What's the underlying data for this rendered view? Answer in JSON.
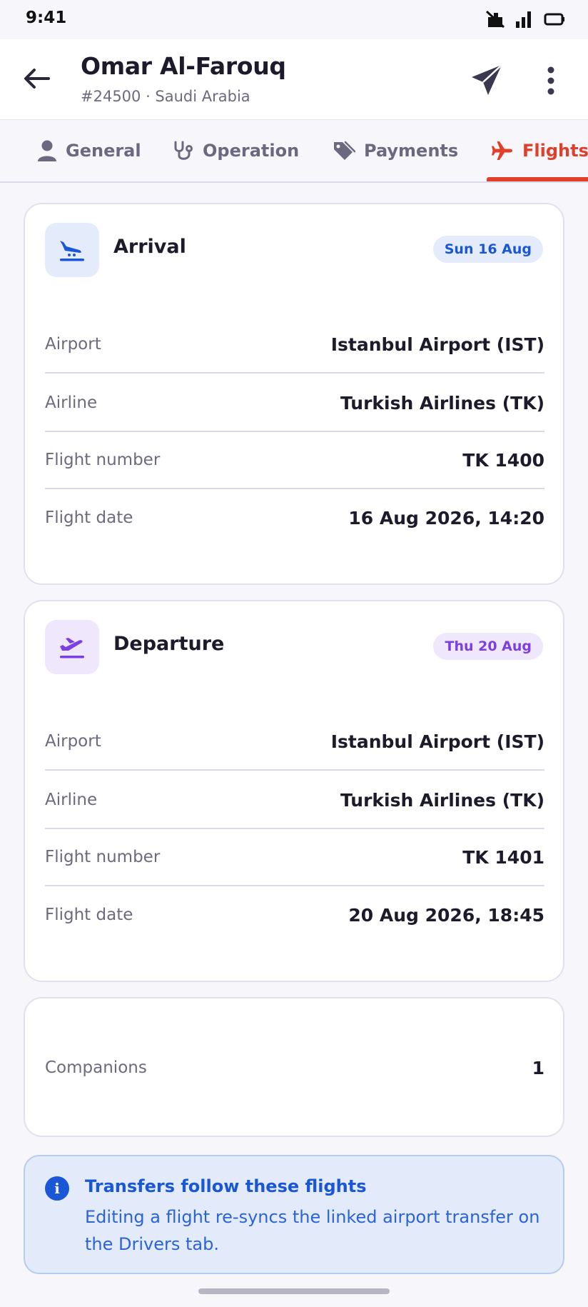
{
  "status_bar": {
    "time": "9:41"
  },
  "header": {
    "title": "Omar Al-Farouq",
    "subtitle": "#24500 · Saudi Arabia"
  },
  "tabs": [
    {
      "label": "General",
      "icon": "person-icon",
      "active": false
    },
    {
      "label": "Operation",
      "icon": "stethoscope-icon",
      "active": false
    },
    {
      "label": "Payments",
      "icon": "tag-icon",
      "active": false
    },
    {
      "label": "Flights",
      "icon": "airplane-icon",
      "active": true
    }
  ],
  "arrival": {
    "title": "Arrival",
    "date_badge": "Sun 16 Aug",
    "rows": [
      {
        "label": "Airport",
        "value": "Istanbul Airport (IST)"
      },
      {
        "label": "Airline",
        "value": "Turkish Airlines (TK)"
      },
      {
        "label": "Flight number",
        "value": "TK 1400"
      },
      {
        "label": "Flight date",
        "value": "16 Aug 2026, 14:20"
      }
    ]
  },
  "departure": {
    "title": "Departure",
    "date_badge": "Thu 20 Aug",
    "rows": [
      {
        "label": "Airport",
        "value": "Istanbul Airport (IST)"
      },
      {
        "label": "Airline",
        "value": "Turkish Airlines (TK)"
      },
      {
        "label": "Flight number",
        "value": "TK 1401"
      },
      {
        "label": "Flight date",
        "value": "20 Aug 2026, 18:45"
      }
    ]
  },
  "companions": {
    "label": "Companions",
    "value": "1"
  },
  "info": {
    "title": "Transfers follow these flights",
    "text": "Editing a flight re-syncs the linked airport transfer on the Drivers tab."
  },
  "colors": {
    "accent": "#e0402a",
    "arrival_accent": "#1a57d6",
    "departure_accent": "#7b3fe4",
    "info_accent": "#1a57d6"
  }
}
